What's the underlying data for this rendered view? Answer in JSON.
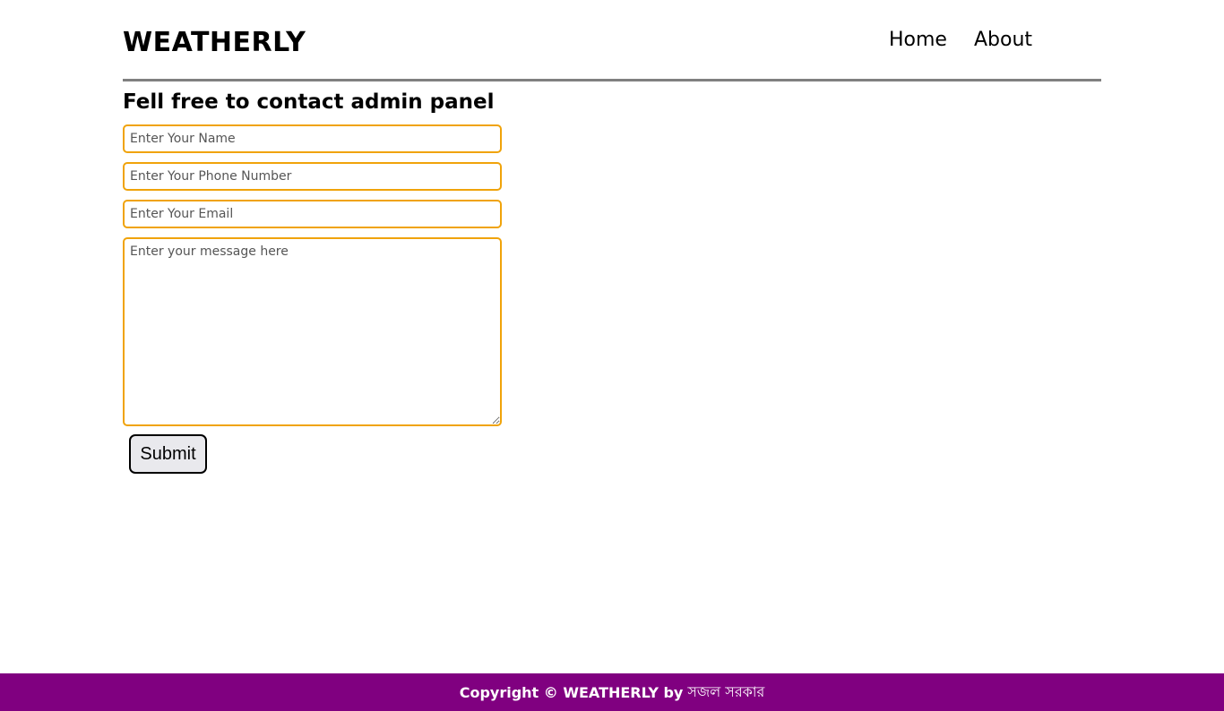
{
  "header": {
    "logo": "WEATHERLY",
    "nav": [
      {
        "label": "Home"
      },
      {
        "label": "About"
      }
    ]
  },
  "main": {
    "title": "Fell free to contact admin panel",
    "form": {
      "name_placeholder": "Enter Your Name",
      "phone_placeholder": "Enter Your Phone Number",
      "email_placeholder": "Enter Your Email",
      "message_placeholder": "Enter your message here",
      "submit_label": "Submit"
    }
  },
  "footer": {
    "copyright": "Copyright © WEATHERLY by",
    "author": "সজল সরকার"
  },
  "colors": {
    "accent_border": "#f0a30a",
    "footer_bg": "#800080",
    "divider": "#808080"
  }
}
